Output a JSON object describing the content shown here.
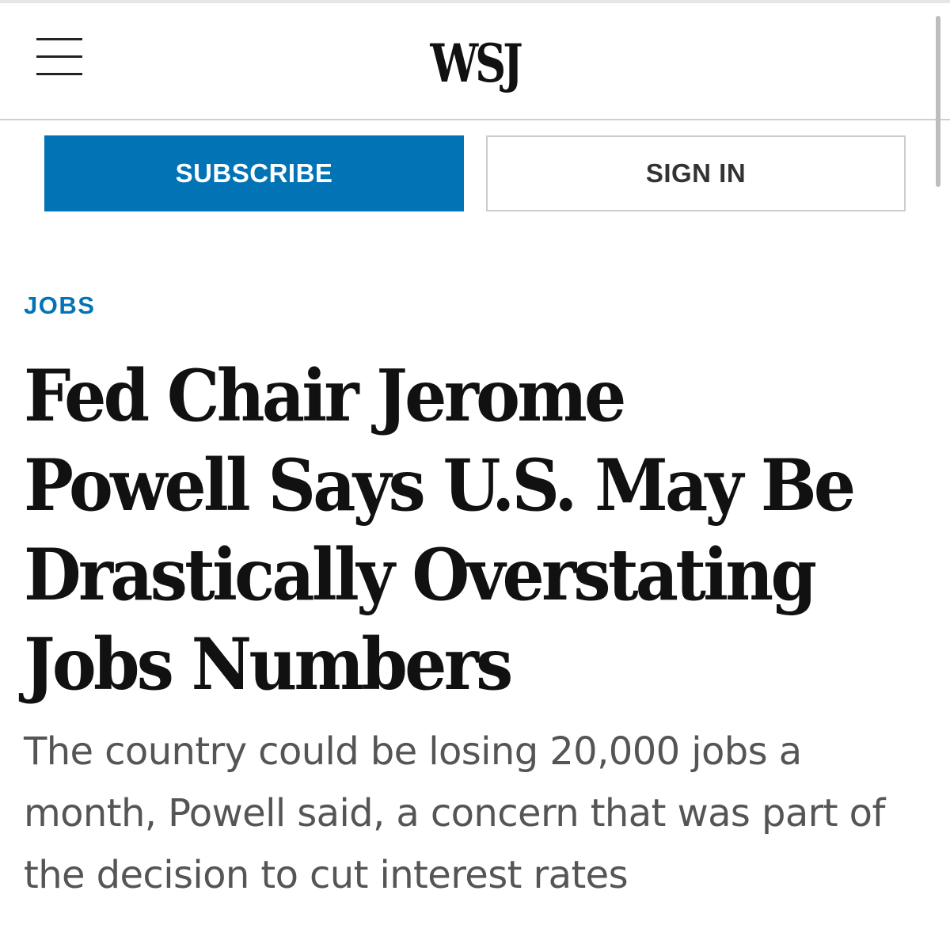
{
  "header": {
    "logo": "WSJ"
  },
  "auth": {
    "subscribe_label": "SUBSCRIBE",
    "signin_label": "SIGN IN"
  },
  "article": {
    "section": "JOBS",
    "headline": "Fed Chair Jerome Powell Says U.S. May Be Drastically Overstating Jobs Numbers",
    "dek": "The country could be losing 20,000 jobs a month, Powell said, a concern that was part of the decision to cut interest rates"
  },
  "colors": {
    "accent": "#0274b6",
    "headline": "#111111",
    "dek": "#555555"
  },
  "icons": {
    "menu": "hamburger-menu-icon"
  }
}
